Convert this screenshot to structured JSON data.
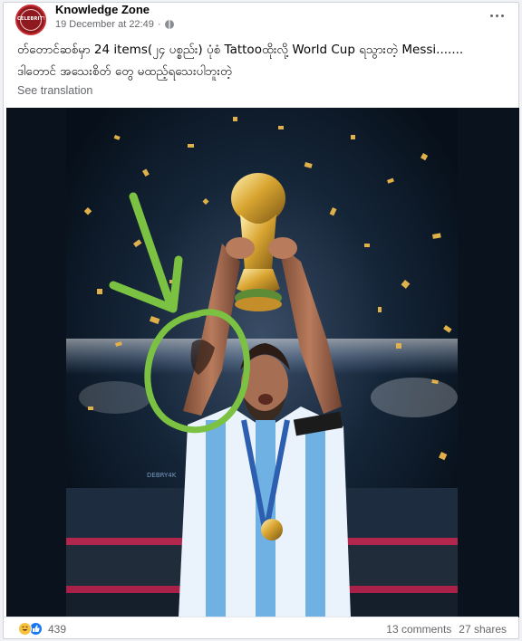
{
  "post": {
    "page_name": "Knowledge Zone",
    "avatar_text": "CELEBRITY",
    "timestamp": "19 December at 22:49",
    "privacy_separator": "·",
    "text_line_1": "တ်တောင်ဆစ်မှာ 24 items(၂၄ ပစ္စည်း) ပုံစံ Tattooထိုးလို့ World Cup ရသွားတဲ့ Messi.......",
    "text_line_2": "ဒါတောင် အသေးစိတ် တွေ မထည့်ရသေးပါဘူးတဲ့",
    "see_translation": "See translation",
    "photo_watermark": "DEBRY4K",
    "reaction_count": "439",
    "comments": "13 comments",
    "shares": "27 shares"
  },
  "colors": {
    "annotation_green": "#7cc242",
    "facebook_blue": "#1877f2",
    "haha_yellow": "#f7c23b",
    "jersey_blue": "#6fb1e3",
    "background": "#0b1520"
  },
  "icons": {
    "privacy": "globe-icon",
    "menu": "more-options-icon",
    "reaction_1": "haha-icon",
    "reaction_2": "like-icon"
  }
}
